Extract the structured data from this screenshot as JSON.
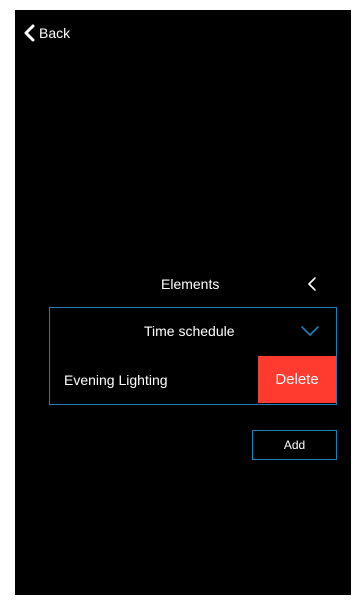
{
  "nav": {
    "back_label": "Back",
    "back_icon": "chevron-left-icon"
  },
  "elements": {
    "title": "Elements",
    "collapse_icon": "chevron-left-icon",
    "schedule_label": "Time schedule",
    "dropdown_icon": "chevron-down-icon",
    "items": [
      {
        "label": "Evening Lighting",
        "delete_label": "Delete"
      }
    ],
    "add_label": "Add"
  },
  "colors": {
    "background": "#000000",
    "accent": "#1f7fb6",
    "delete": "#ff3b30",
    "text": "#ffffff"
  }
}
